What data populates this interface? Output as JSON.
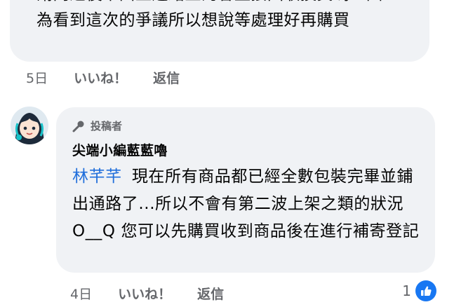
{
  "top_comment": {
    "text": "請問之後市面上通路上的會直接回收換貨嗎？因\n為看到這次的爭議所以想說等處理好再購買",
    "time": "5日",
    "like_label": "いいね！",
    "reply_label": "返信"
  },
  "reply": {
    "badge_label": "投稿者",
    "author": "尖端小編藍藍嚕",
    "mention": "林芊芊",
    "body": "現在所有商品都已經全數包裝完畢並鋪出通路了...所以不會有第二波上架之類的狀況 O__Q 您可以先購買收到商品後在進行補寄登記",
    "time": "4日",
    "like_label": "いいね！",
    "reply_label": "返信",
    "reaction_count": "1",
    "reaction_icon": "thumbs-up-icon",
    "accent_color": "#1877f2",
    "mention_color": "#216fdb"
  }
}
